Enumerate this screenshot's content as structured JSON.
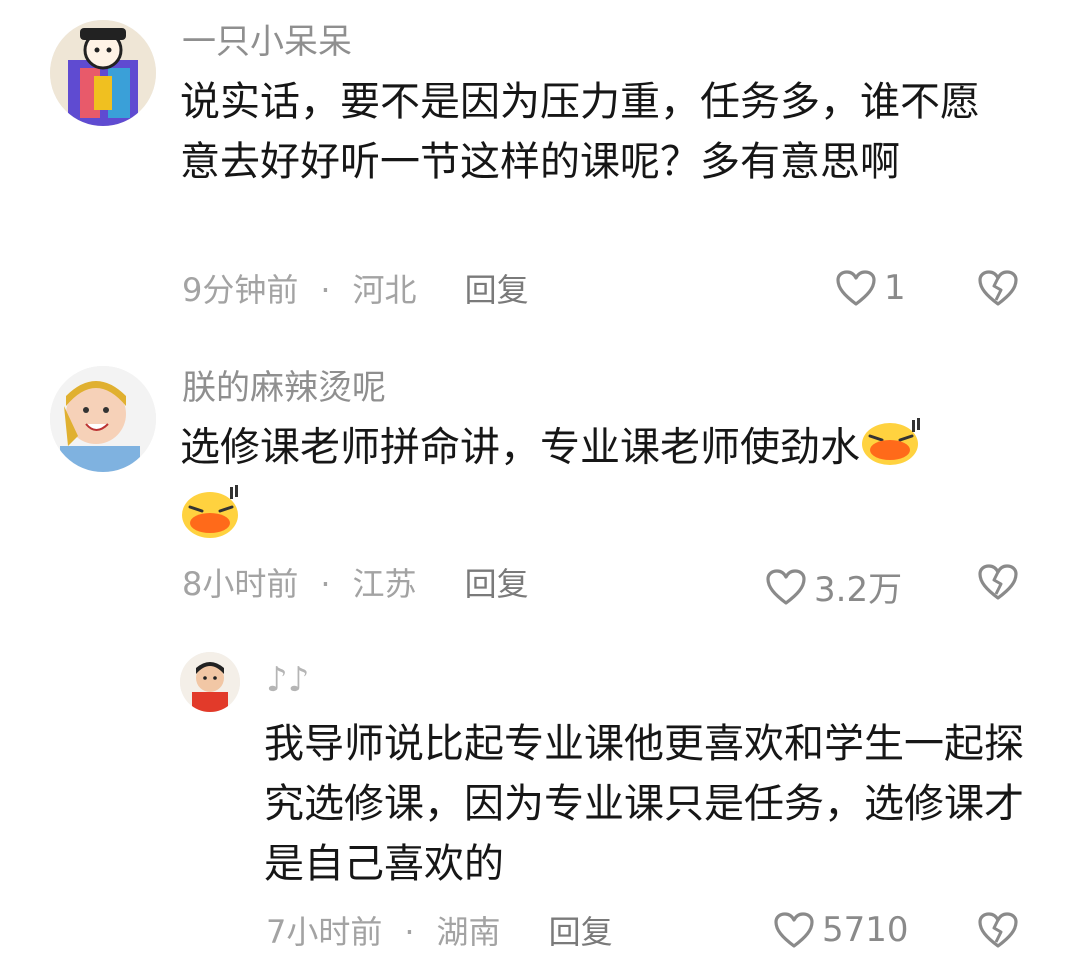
{
  "comments": [
    {
      "username": "一只小呆呆",
      "text": "说实话，要不是因为压力重，任务多，谁不愿意去好好听一节这样的课呢？多有意思啊",
      "time": "9分钟前",
      "location": "河北",
      "reply_label": "回复",
      "likes": "1"
    },
    {
      "username": "朕的麻辣烫呢",
      "text": "选修课老师拼命讲，专业课老师使劲水",
      "time": "8小时前",
      "location": "江苏",
      "reply_label": "回复",
      "likes": "3.2万"
    },
    {
      "username": "♪♪",
      "text": "我导师说比起专业课他更喜欢和学生一起探究选修课，因为专业课只是任务，选修课才是自己喜欢的",
      "time": "7小时前",
      "location": "湖南",
      "reply_label": "回复",
      "likes": "5710"
    }
  ],
  "separator": "·",
  "colors": {
    "text": "#161616",
    "muted": "#a3a3a3",
    "username": "#8f8f8f",
    "icon": "#8a8a8a"
  },
  "icons": {
    "like": "heart-outline-icon",
    "dislike": "broken-heart-icon",
    "emoji": "laughing-duck-emoji"
  }
}
